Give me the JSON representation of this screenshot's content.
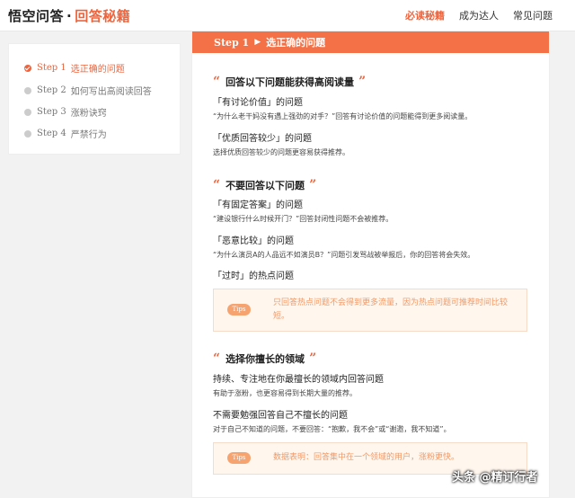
{
  "header": {
    "logo_main": "悟空问答",
    "logo_dot": "·",
    "logo_sub": "回答秘籍",
    "nav": [
      "必读秘籍",
      "成为达人",
      "常见问题"
    ]
  },
  "sidebar": {
    "steps": [
      {
        "num": "Step 1",
        "label": "选正确的问题"
      },
      {
        "num": "Step 2",
        "label": "如何写出高阅读回答"
      },
      {
        "num": "Step 3",
        "label": "涨粉诀窍"
      },
      {
        "num": "Step 4",
        "label": "严禁行为"
      }
    ]
  },
  "main": {
    "banner_step": "Step 1",
    "banner_arrow": "▶",
    "banner_title": "选正确的问题",
    "sections": [
      {
        "title": "回答以下问题能获得高阅读量",
        "items": [
          {
            "title": "「有讨论价值」的问题",
            "desc": "“为什么老干妈没有遇上强劲的对手？”回答有讨论价值的问题能得到更多阅读量。"
          },
          {
            "title": "「优质回答较少」的问题",
            "desc": "选择优质回答较少的问题更容易获得推荐。"
          }
        ]
      },
      {
        "title": "不要回答以下问题",
        "items": [
          {
            "title": "「有固定答案」的问题",
            "desc": "“建设银行什么时候开门？”回答封闭性问题不会被推荐。"
          },
          {
            "title": "「恶意比较」的问题",
            "desc": "“为什么演员A的人品远不如演员B？”问题引发骂战被举报后，你的回答将会失效。"
          },
          {
            "title": "「过时」的热点问题",
            "desc": ""
          }
        ],
        "tips": "只回答热点问题不会得到更多流量，因为热点问题可推荐时间比较短。"
      },
      {
        "title": "选择你擅长的领域",
        "items": [
          {
            "title": "持续、专注地在你最擅长的领域内回答问题",
            "desc": "有助于涨粉，也更容易得到长期大量的推荐。"
          },
          {
            "title": "不需要勉强回答自己不擅长的问题",
            "desc": "对于自己不知道的问题，不要回答：“抱歉，我不会”或“谢邀，我不知道”。"
          }
        ],
        "tips": "数据表明：回答集中在一个领域的用户，涨粉更快。"
      }
    ],
    "tips_badge": "Tips"
  },
  "watermark": "头条 @精订行者",
  "colors": {
    "accent": "#f0643c",
    "banner": "#f47148",
    "tips_bg": "#fff6ee",
    "tips_text": "#f09a68"
  }
}
